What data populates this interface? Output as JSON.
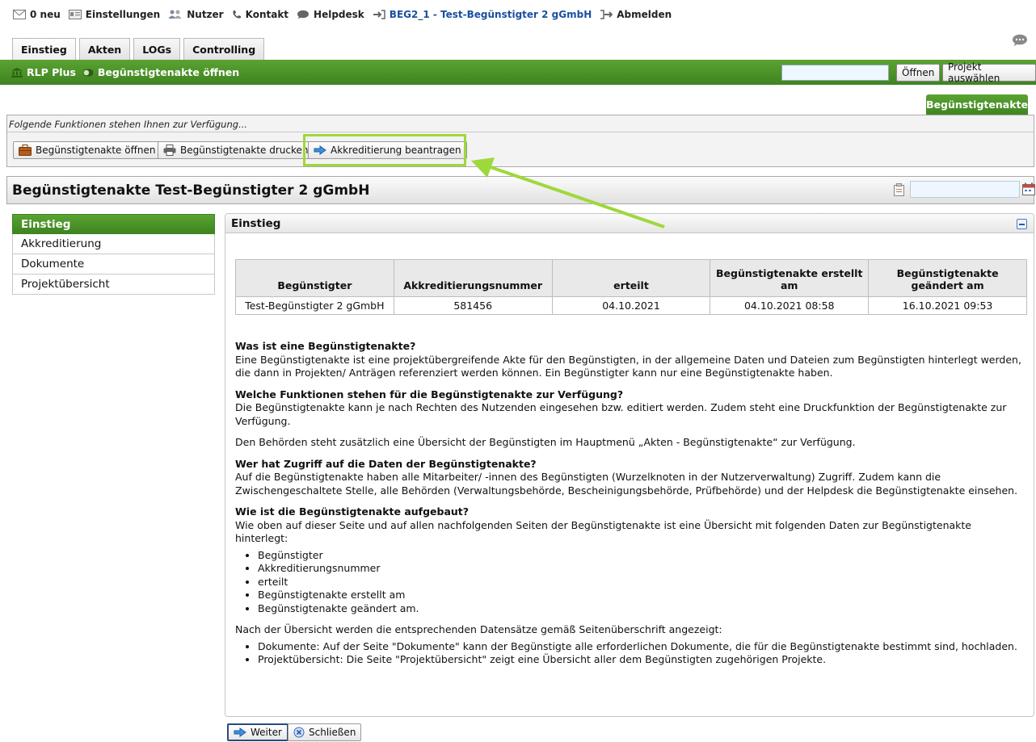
{
  "topbar": {
    "messages": "0 neu",
    "settings": "Einstellungen",
    "users": "Nutzer",
    "contact": "Kontakt",
    "helpdesk": "Helpdesk",
    "current_user": "BEG2_1 - Test-Begünstigter 2 gGmbH",
    "logout": "Abmelden"
  },
  "tabs": [
    "Einstieg",
    "Akten",
    "LOGs",
    "Controlling"
  ],
  "greenbar": {
    "crumb_home": "RLP Plus",
    "crumb_current": "Begünstigtenakte öffnen",
    "open_button": "Öffnen",
    "select_project_button": "Projekt auswählen"
  },
  "right_tab": "Begünstigtenakte",
  "functions": {
    "hint": "Folgende Funktionen stehen Ihnen zur Verfügung...",
    "open": "Begünstigtenakte öffnen",
    "print": "Begünstigtenakte drucken",
    "accredit": "Akkreditierung beantragen"
  },
  "page_title": "Begünstigtenakte Test-Begünstigter 2 gGmbH",
  "nav": [
    "Einstieg",
    "Akkreditierung",
    "Dokumente",
    "Projektübersicht"
  ],
  "panel": {
    "title": "Einstieg",
    "table": {
      "headers": [
        "Begünstigter",
        "Akkreditierungsnummer",
        "erteilt",
        "Begünstigtenakte erstellt am",
        "Begünstigtenakte geändert am"
      ],
      "rows": [
        [
          "Test-Begünstigter 2 gGmbH",
          "581456",
          "04.10.2021",
          "04.10.2021 08:58",
          "16.10.2021 09:53"
        ]
      ]
    },
    "sections": [
      {
        "heading": "Was ist eine Begünstigtenakte?",
        "text": "Eine Begünstigtenakte ist eine projektübergreifende Akte für den Begünstigten, in der allgemeine Daten und Dateien zum Begünstigten hinterlegt werden, die dann in Projekten/ Anträgen referenziert werden können. Ein Begünstigter kann nur eine Begünstigtenakte haben."
      },
      {
        "heading": "Welche Funktionen stehen für die Begünstigtenakte zur Verfügung?",
        "text": "Die Begünstigtenakte kann je nach Rechten des Nutzenden eingesehen bzw. editiert werden. Zudem steht eine Druckfunktion der Begünstigtenakte zur Verfügung."
      }
    ],
    "authority_note": "Den Behörden steht zusätzlich eine Übersicht der Begünstigten im Hauptmenü „Akten - Begünstigtenakte“ zur Verfügung.",
    "access": {
      "heading": "Wer hat Zugriff auf die Daten der Begünstigtenakte?",
      "text": "Auf die Begünstigtenakte haben alle Mitarbeiter/ -innen des Begünstigten (Wurzelknoten in der Nutzerverwaltung) Zugriff. Zudem kann die Zwischengeschaltete Stelle, alle Behörden (Verwaltungsbehörde, Bescheinigungsbehörde, Prüfbehörde) und der Helpdesk die Begünstigtenakte einsehen."
    },
    "structure": {
      "heading": "Wie ist die Begünstigtenakte aufgebaut?",
      "text": "Wie oben auf dieser Seite und auf allen nachfolgenden Seiten der Begünstigtenakte ist eine Übersicht mit folgenden Daten zur Begünstigtenakte hinterlegt:",
      "items": [
        "Begünstigter",
        "Akkreditierungsnummer",
        "erteilt",
        "Begünstigtenakte erstellt am",
        "Begünstigtenakte geändert am."
      ]
    },
    "after_text": "Nach der Übersicht werden die entsprechenden Datensätze gemäß Seitenüberschrift angezeigt:",
    "after_items": [
      "Dokumente: Auf der Seite \"Dokumente\" kann der Begünstigte alle erforderlichen Dokumente, die für die Begünstigtenakte bestimmt sind, hochladen.",
      "Projektübersicht: Die Seite \"Projektübersicht\" zeigt eine Übersicht aller dem Begünstigten zugehörigen Projekte."
    ]
  },
  "bottom": {
    "next": "Weiter",
    "close": "Schließen"
  },
  "colors": {
    "green": "#4a9428",
    "highlight": "#9fd83a",
    "link_blue": "#1a4fa0"
  },
  "icons": [
    "mail-icon",
    "settings-card-icon",
    "users-icon",
    "phone-icon",
    "chat-bubble-icon",
    "login-arrow-icon",
    "logout-icon",
    "bank-icon",
    "toggle-icon",
    "briefcase-icon",
    "printer-icon",
    "arrow-right-icon",
    "calendar-icon",
    "close-circle-icon"
  ]
}
